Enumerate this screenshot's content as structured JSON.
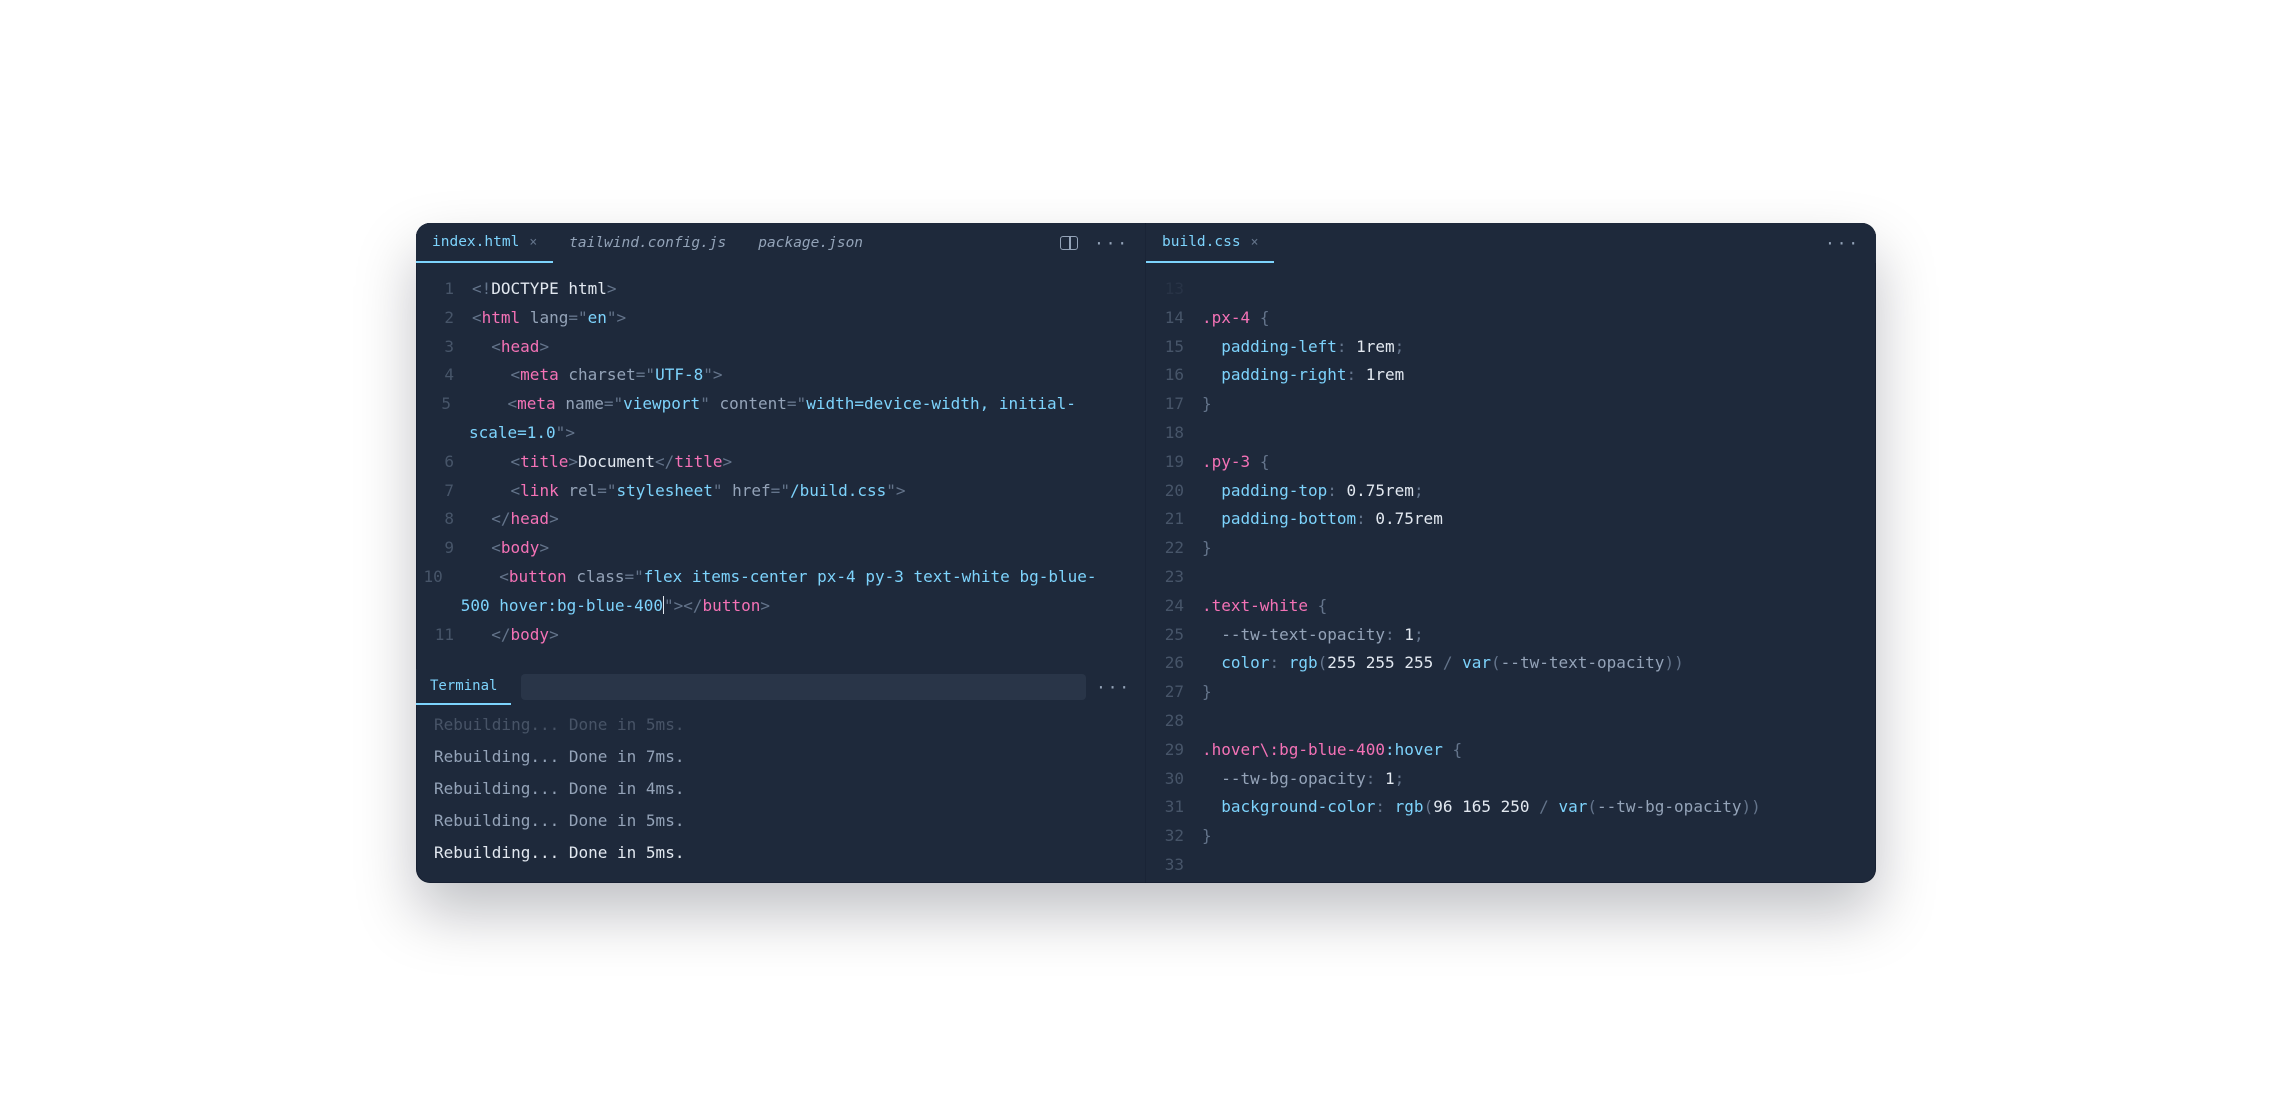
{
  "left": {
    "tabs": [
      {
        "label": "index.html",
        "active": true,
        "closeable": true
      },
      {
        "label": "tailwind.config.js",
        "active": false,
        "closeable": false
      },
      {
        "label": "package.json",
        "active": false,
        "closeable": false
      }
    ],
    "code": [
      {
        "n": "1",
        "indent": 0,
        "tokens": [
          [
            "punct",
            "<!"
          ],
          [
            "text",
            "DOCTYPE html"
          ],
          [
            "punct",
            ">"
          ]
        ]
      },
      {
        "n": "2",
        "indent": 0,
        "tokens": [
          [
            "punct",
            "<"
          ],
          [
            "tag",
            "html"
          ],
          [
            "text",
            " "
          ],
          [
            "attr",
            "lang"
          ],
          [
            "op",
            "="
          ],
          [
            "punct",
            "\""
          ],
          [
            "str",
            "en"
          ],
          [
            "punct",
            "\""
          ],
          [
            "punct",
            ">"
          ]
        ]
      },
      {
        "n": "3",
        "indent": 1,
        "tokens": [
          [
            "punct",
            "<"
          ],
          [
            "tag",
            "head"
          ],
          [
            "punct",
            ">"
          ]
        ]
      },
      {
        "n": "4",
        "indent": 2,
        "tokens": [
          [
            "punct",
            "<"
          ],
          [
            "tag",
            "meta"
          ],
          [
            "text",
            " "
          ],
          [
            "attr",
            "charset"
          ],
          [
            "op",
            "="
          ],
          [
            "punct",
            "\""
          ],
          [
            "str",
            "UTF-8"
          ],
          [
            "punct",
            "\""
          ],
          [
            "punct",
            ">"
          ]
        ]
      },
      {
        "n": "5",
        "indent": 2,
        "tokens": [
          [
            "punct",
            "<"
          ],
          [
            "tag",
            "meta"
          ],
          [
            "text",
            " "
          ],
          [
            "attr",
            "name"
          ],
          [
            "op",
            "="
          ],
          [
            "punct",
            "\""
          ],
          [
            "str",
            "viewport"
          ],
          [
            "punct",
            "\""
          ],
          [
            "text",
            " "
          ],
          [
            "attr",
            "content"
          ],
          [
            "op",
            "="
          ],
          [
            "punct",
            "\""
          ],
          [
            "str",
            "width=device-width, initial-scale=1.0"
          ],
          [
            "punct",
            "\""
          ],
          [
            "punct",
            ">"
          ]
        ]
      },
      {
        "n": "6",
        "indent": 2,
        "tokens": [
          [
            "punct",
            "<"
          ],
          [
            "tag",
            "title"
          ],
          [
            "punct",
            ">"
          ],
          [
            "text",
            "Document"
          ],
          [
            "punct",
            "</"
          ],
          [
            "tag",
            "title"
          ],
          [
            "punct",
            ">"
          ]
        ]
      },
      {
        "n": "7",
        "indent": 2,
        "tokens": [
          [
            "punct",
            "<"
          ],
          [
            "tag",
            "link"
          ],
          [
            "text",
            " "
          ],
          [
            "attr",
            "rel"
          ],
          [
            "op",
            "="
          ],
          [
            "punct",
            "\""
          ],
          [
            "str",
            "stylesheet"
          ],
          [
            "punct",
            "\""
          ],
          [
            "text",
            " "
          ],
          [
            "attr",
            "href"
          ],
          [
            "op",
            "="
          ],
          [
            "punct",
            "\""
          ],
          [
            "str",
            "/build.css"
          ],
          [
            "punct",
            "\""
          ],
          [
            "punct",
            ">"
          ]
        ]
      },
      {
        "n": "8",
        "indent": 1,
        "tokens": [
          [
            "punct",
            "</"
          ],
          [
            "tag",
            "head"
          ],
          [
            "punct",
            ">"
          ]
        ]
      },
      {
        "n": "9",
        "indent": 1,
        "tokens": [
          [
            "punct",
            "<"
          ],
          [
            "tag",
            "body"
          ],
          [
            "punct",
            ">"
          ]
        ]
      },
      {
        "n": "10",
        "indent": 2,
        "tokens": [
          [
            "punct",
            "<"
          ],
          [
            "tag",
            "button"
          ],
          [
            "text",
            " "
          ],
          [
            "attr",
            "class"
          ],
          [
            "op",
            "="
          ],
          [
            "punct",
            "\""
          ],
          [
            "str",
            "flex items-center px-4 py-3 text-white bg-blue-500 hover:bg-blue-400"
          ],
          [
            "cursor",
            ""
          ],
          [
            "punct",
            "\""
          ],
          [
            "punct",
            ">"
          ],
          [
            "punct",
            "</"
          ],
          [
            "tag",
            "button"
          ],
          [
            "punct",
            ">"
          ]
        ]
      },
      {
        "n": "11",
        "indent": 1,
        "tokens": [
          [
            "punct",
            "</"
          ],
          [
            "tag",
            "body"
          ],
          [
            "punct",
            ">"
          ]
        ]
      }
    ]
  },
  "terminal": {
    "tab": "Terminal",
    "lines": [
      "Rebuilding... Done in 5ms.",
      "Rebuilding... Done in 7ms.",
      "Rebuilding... Done in 4ms.",
      "Rebuilding... Done in 5ms.",
      "Rebuilding... Done in 5ms."
    ]
  },
  "right": {
    "tabs": [
      {
        "label": "build.css",
        "active": true,
        "closeable": true
      }
    ],
    "code": [
      {
        "n": "13",
        "indent": 0,
        "tokens": []
      },
      {
        "n": "14",
        "indent": 0,
        "tokens": [
          [
            "csssel",
            ".px-4"
          ],
          [
            "text",
            " "
          ],
          [
            "punct",
            "{"
          ]
        ]
      },
      {
        "n": "15",
        "indent": 1,
        "tokens": [
          [
            "cssprop",
            "padding-left"
          ],
          [
            "punct",
            ": "
          ],
          [
            "cssnum",
            "1rem"
          ],
          [
            "punct",
            ";"
          ]
        ]
      },
      {
        "n": "16",
        "indent": 1,
        "tokens": [
          [
            "cssprop",
            "padding-right"
          ],
          [
            "punct",
            ": "
          ],
          [
            "cssnum",
            "1rem"
          ]
        ]
      },
      {
        "n": "17",
        "indent": 0,
        "tokens": [
          [
            "punct",
            "}"
          ]
        ]
      },
      {
        "n": "18",
        "indent": 0,
        "tokens": []
      },
      {
        "n": "19",
        "indent": 0,
        "tokens": [
          [
            "csssel",
            ".py-3"
          ],
          [
            "text",
            " "
          ],
          [
            "punct",
            "{"
          ]
        ]
      },
      {
        "n": "20",
        "indent": 1,
        "tokens": [
          [
            "cssprop",
            "padding-top"
          ],
          [
            "punct",
            ": "
          ],
          [
            "cssnum",
            "0.75rem"
          ],
          [
            "punct",
            ";"
          ]
        ]
      },
      {
        "n": "21",
        "indent": 1,
        "tokens": [
          [
            "cssprop",
            "padding-bottom"
          ],
          [
            "punct",
            ": "
          ],
          [
            "cssnum",
            "0.75rem"
          ]
        ]
      },
      {
        "n": "22",
        "indent": 0,
        "tokens": [
          [
            "punct",
            "}"
          ]
        ]
      },
      {
        "n": "23",
        "indent": 0,
        "tokens": []
      },
      {
        "n": "24",
        "indent": 0,
        "tokens": [
          [
            "csssel",
            ".text-white"
          ],
          [
            "text",
            " "
          ],
          [
            "punct",
            "{"
          ]
        ]
      },
      {
        "n": "25",
        "indent": 1,
        "tokens": [
          [
            "cssvar",
            "--tw-text-opacity"
          ],
          [
            "punct",
            ": "
          ],
          [
            "cssnum",
            "1"
          ],
          [
            "punct",
            ";"
          ]
        ]
      },
      {
        "n": "26",
        "indent": 1,
        "tokens": [
          [
            "cssprop",
            "color"
          ],
          [
            "punct",
            ": "
          ],
          [
            "cssfunc",
            "rgb"
          ],
          [
            "punct",
            "("
          ],
          [
            "cssnum",
            "255 255 255"
          ],
          [
            "punct",
            " / "
          ],
          [
            "cssfunc",
            "var"
          ],
          [
            "punct",
            "("
          ],
          [
            "cssvar",
            "--tw-text-opacity"
          ],
          [
            "punct",
            "))"
          ]
        ]
      },
      {
        "n": "27",
        "indent": 0,
        "tokens": [
          [
            "punct",
            "}"
          ]
        ]
      },
      {
        "n": "28",
        "indent": 0,
        "tokens": []
      },
      {
        "n": "29",
        "indent": 0,
        "tokens": [
          [
            "csssel",
            ".hover\\:bg-blue-400"
          ],
          [
            "cssprop",
            ":hover"
          ],
          [
            "text",
            " "
          ],
          [
            "punct",
            "{"
          ]
        ]
      },
      {
        "n": "30",
        "indent": 1,
        "tokens": [
          [
            "cssvar",
            "--tw-bg-opacity"
          ],
          [
            "punct",
            ": "
          ],
          [
            "cssnum",
            "1"
          ],
          [
            "punct",
            ";"
          ]
        ]
      },
      {
        "n": "31",
        "indent": 1,
        "tokens": [
          [
            "cssprop",
            "background-color"
          ],
          [
            "punct",
            ": "
          ],
          [
            "cssfunc",
            "rgb"
          ],
          [
            "punct",
            "("
          ],
          [
            "cssnum",
            "96 165 250"
          ],
          [
            "punct",
            " / "
          ],
          [
            "cssfunc",
            "var"
          ],
          [
            "punct",
            "("
          ],
          [
            "cssvar",
            "--tw-bg-opacity"
          ],
          [
            "punct",
            "))"
          ]
        ]
      },
      {
        "n": "32",
        "indent": 0,
        "tokens": [
          [
            "punct",
            "}"
          ]
        ]
      },
      {
        "n": "33",
        "indent": 0,
        "tokens": []
      }
    ]
  },
  "colors": {
    "background": "#1e293b",
    "accent": "#7dd3fc",
    "tag": "#f472b6",
    "muted": "#94a3b8"
  }
}
